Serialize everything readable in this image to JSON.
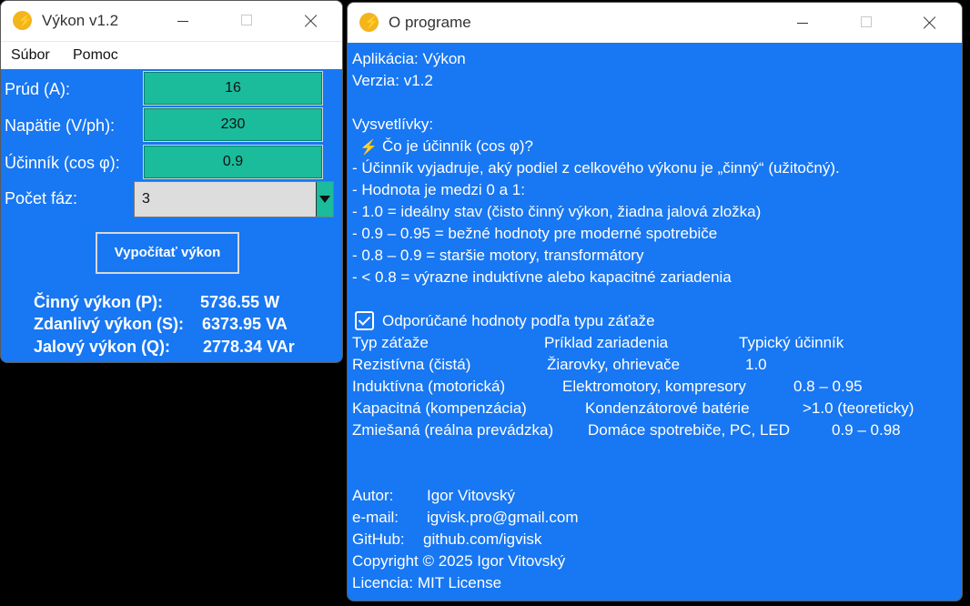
{
  "vykon": {
    "title": "Výkon v1.2",
    "menu": [
      "Súbor",
      "Pomoc"
    ],
    "fields": [
      {
        "label": "Prúd (A):",
        "value": "16"
      },
      {
        "label": "Napätie (V/ph):",
        "value": "230"
      },
      {
        "label": "Účinník (cos φ):",
        "value": "0.9"
      }
    ],
    "phases": {
      "label": "Počet fáz:",
      "value": "3"
    },
    "calc_button": "Vypočítať výkon",
    "results": [
      {
        "label": "Činný výkon (P):",
        "value": "5736.55 W"
      },
      {
        "label": "Zdanlivý výkon (S):",
        "value": "6373.95 VA"
      },
      {
        "label": "Jalový výkon (Q):",
        "value": "2778.34 VAr"
      }
    ]
  },
  "about": {
    "title": "O programe",
    "app_line": "Aplikácia: Výkon",
    "version_line": "Verzia: v1.2",
    "legend_heading": "Vysvetlívky:",
    "question": "Čo je účinník (cos φ)?",
    "bullets": [
      "- Účinník vyjadruje, aký podiel z celkového výkonu je „činný“ (užitočný).",
      "- Hodnota je medzi 0 a 1:",
      "- 1.0 = ideálny stav (čisto činný výkon, žiadna jalová zložka)",
      "- 0.9 – 0.95 = bežné hodnoty pre moderné spotrebiče",
      "- 0.8 – 0.9 = staršie motory, transformátory",
      "- < 0.8 = výrazne induktívne alebo kapacitné zariadenia"
    ],
    "recommended_heading": "Odporúčané hodnoty podľa typu záťaže",
    "table_header": {
      "type": "Typ záťaže",
      "example": "Príklad zariadenia",
      "pf": "Typický účinník"
    },
    "table_rows": [
      {
        "type": "Rezistívna (čistá)",
        "example": "Žiarovky, ohrievače",
        "pf": "1.0"
      },
      {
        "type": "Induktívna (motorická)",
        "example": "Elektromotory, kompresory",
        "pf": "0.8 – 0.95"
      },
      {
        "type": "Kapacitná (kompenzácia)",
        "example": "Kondenzátorové batérie",
        "pf": ">1.0 (teoreticky)"
      },
      {
        "type": "Zmiešaná (reálna prevádzka)",
        "example": "Domáce spotrebiče, PC, LED",
        "pf": "0.9 – 0.98"
      }
    ],
    "author": {
      "label": "Autor:",
      "value": "Igor Vitovský"
    },
    "email": {
      "label": "e-mail:",
      "value": "igvisk.pro@gmail.com"
    },
    "github": {
      "label": "GitHub:",
      "value": "github.com/igvisk"
    },
    "copyright": "Copyright © 2025 Igor Vitovský",
    "license": "Licencia: MIT License"
  }
}
